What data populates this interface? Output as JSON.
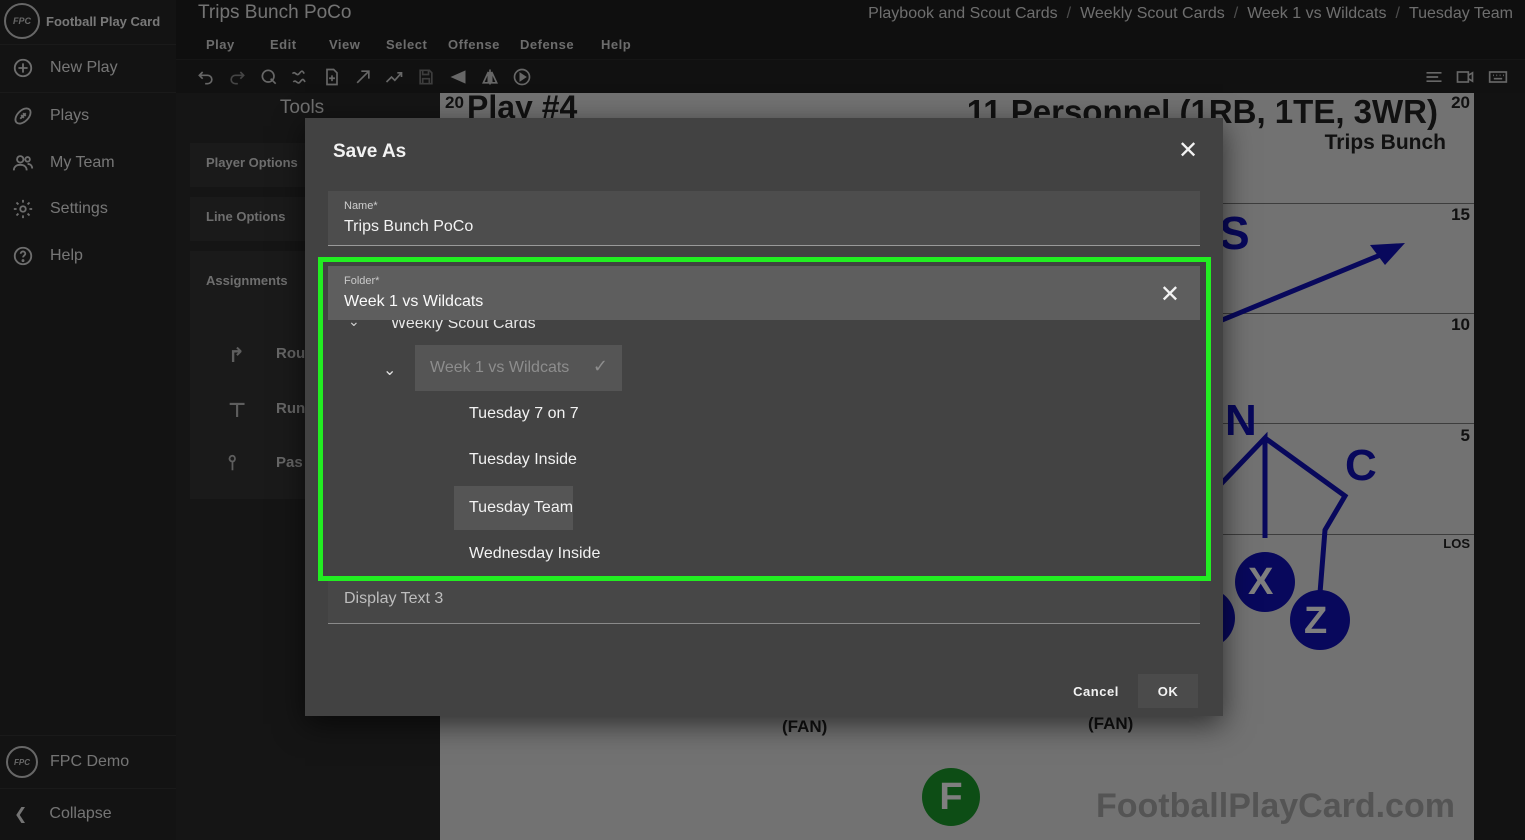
{
  "app": {
    "brand": "Football Play Card",
    "logo_text": "FPC",
    "document_title": "Trips Bunch PoCo"
  },
  "breadcrumbs": [
    "Playbook and Scout Cards",
    "Weekly Scout Cards",
    "Week 1 vs Wildcats",
    "Tuesday Team"
  ],
  "breadcrumb_separator": "/",
  "sidebar": {
    "items": [
      {
        "label": "New Play",
        "icon": "plus-circle-icon"
      },
      {
        "label": "Plays",
        "icon": "football-icon"
      },
      {
        "label": "My Team",
        "icon": "team-icon"
      },
      {
        "label": "Settings",
        "icon": "gear-icon"
      },
      {
        "label": "Help",
        "icon": "help-circle-icon"
      }
    ],
    "account": "FPC Demo",
    "collapse_label": "Collapse"
  },
  "menu": [
    "Play",
    "Edit",
    "View",
    "Select",
    "Offense",
    "Defense",
    "Help"
  ],
  "toolbar": {
    "icons": [
      "undo-icon",
      "redo-icon",
      "lasso-select-icon",
      "freehand-route-icon",
      "new-page-icon",
      "arrow-route-icon",
      "zigzag-route-icon",
      "save-icon",
      "flip-horizontal-icon",
      "mirror-icon",
      "play-animation-icon"
    ],
    "right_icons": [
      "text-align-icon",
      "video-icon",
      "keyboard-icon"
    ]
  },
  "tools": {
    "title": "Tools",
    "cards": [
      "Player Options",
      "Line Options",
      "Assignments"
    ],
    "assignment_rows": [
      {
        "label": "Rou",
        "icon": "route-icon"
      },
      {
        "label": "Run",
        "icon": "run-block-icon"
      },
      {
        "label": "Pas",
        "icon": "pass-block-icon"
      }
    ]
  },
  "card": {
    "play_number": "Play #4",
    "personnel": "11 Personnel (1RB, 1TE, 3WR)",
    "formation": "Trips Bunch",
    "yard_left": "20",
    "yard_right": "20",
    "yard_markers": [
      "15",
      "10",
      "5"
    ],
    "los_label": "LOS",
    "player_labels": [
      "S",
      "N",
      "C",
      "X",
      "Z",
      "F"
    ],
    "fan_labels": [
      "(FAN)",
      "(FAN)"
    ],
    "watermark": "FootballPlayCard.com",
    "colors": {
      "offense": "#1010b8",
      "f_player": "#1a9a2a"
    }
  },
  "dialog": {
    "title": "Save As",
    "name_label": "Name*",
    "name_value": "Trips Bunch PoCo",
    "folder_label": "Folder*",
    "folder_value": "Week 1 vs Wildcats",
    "tree": {
      "parent": "Weekly Scout Cards",
      "selected": "Week 1 vs Wildcats",
      "children": [
        "Tuesday 7 on 7",
        "Tuesday Inside",
        "Tuesday Team",
        "Wednesday Inside"
      ],
      "highlighted": "Tuesday Team"
    },
    "display_text_placeholder": "Display Text 3",
    "cancel_label": "Cancel",
    "ok_label": "OK"
  },
  "annotation_color": "#22ee22"
}
